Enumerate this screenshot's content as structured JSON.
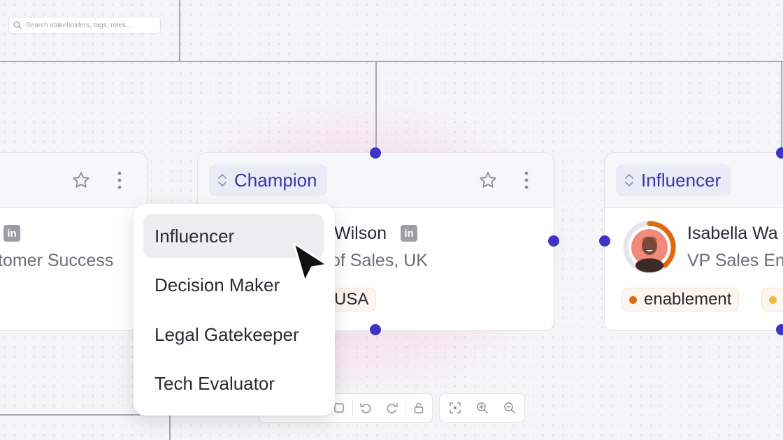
{
  "search": {
    "placeholder": "Search stakeholders, tags, roles..."
  },
  "cards": {
    "left": {
      "title": "tomer Success"
    },
    "center": {
      "role": "Champion",
      "name": "Wilson",
      "title": "of Sales, UK",
      "tag": "USA"
    },
    "right": {
      "role": "Influencer",
      "name": "Isabella Wa",
      "title": "VP Sales En",
      "tag": "enablement"
    }
  },
  "role_menu": {
    "items": [
      {
        "label": "Influencer",
        "highlighted": true
      },
      {
        "label": "Decision Maker",
        "highlighted": false
      },
      {
        "label": "Legal Gatekeeper",
        "highlighted": false
      },
      {
        "label": "Tech Evaluator",
        "highlighted": false
      }
    ]
  },
  "icons": {
    "linkedin": "in",
    "favorite": "star-icon",
    "more": "more-vertical-icon"
  },
  "colors": {
    "accent": "#3d33c4",
    "role_chip_bg": "#ebebf8",
    "role_chip_text": "#3a35a8",
    "tag_bullet": "#e0680f",
    "secondary_tag_bullet": "#f0b840",
    "avatar_ring": "#e0680f"
  }
}
